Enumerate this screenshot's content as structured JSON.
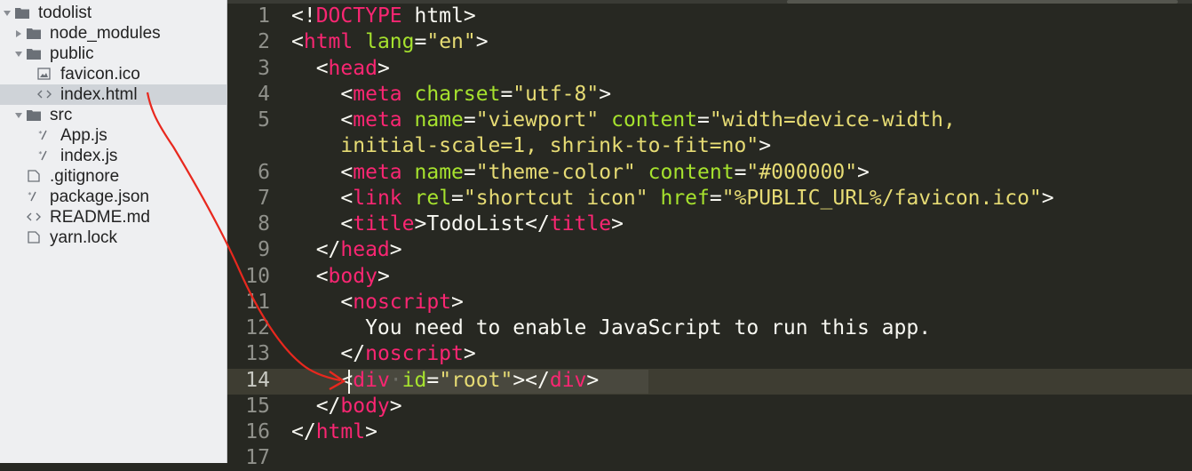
{
  "sidebar": {
    "items": [
      {
        "label": "todolist",
        "type": "folder",
        "expanded": true,
        "icon": "folder-icon"
      },
      {
        "label": "node_modules",
        "type": "folder",
        "expanded": false,
        "icon": "folder-icon"
      },
      {
        "label": "public",
        "type": "folder",
        "expanded": true,
        "icon": "folder-icon"
      },
      {
        "label": "favicon.ico",
        "type": "file",
        "icon": "image-file-icon"
      },
      {
        "label": "index.html",
        "type": "file",
        "icon": "markup-file-icon",
        "selected": true
      },
      {
        "label": "src",
        "type": "folder",
        "expanded": true,
        "icon": "folder-icon"
      },
      {
        "label": "App.js",
        "type": "file",
        "icon": "script-file-icon"
      },
      {
        "label": "index.js",
        "type": "file",
        "icon": "script-file-icon"
      },
      {
        "label": ".gitignore",
        "type": "file",
        "icon": "document-file-icon"
      },
      {
        "label": "package.json",
        "type": "file",
        "icon": "script-file-icon"
      },
      {
        "label": "README.md",
        "type": "file",
        "icon": "markup-file-icon"
      },
      {
        "label": "yarn.lock",
        "type": "file",
        "icon": "document-file-icon"
      }
    ]
  },
  "editor": {
    "current_line": 14,
    "line_numbers": [
      "1",
      "2",
      "3",
      "4",
      "5",
      "",
      "6",
      "7",
      "8",
      "9",
      "10",
      "11",
      "12",
      "13",
      "14",
      "15",
      "16",
      "17"
    ],
    "lines": [
      [
        {
          "c": "p",
          "t": "<!"
        },
        {
          "c": "t",
          "t": "DOCTYPE"
        },
        {
          "c": "p",
          "t": " html>"
        }
      ],
      [
        {
          "c": "p",
          "t": "<"
        },
        {
          "c": "t",
          "t": "html"
        },
        {
          "c": "p",
          "t": " "
        },
        {
          "c": "a",
          "t": "lang"
        },
        {
          "c": "p",
          "t": "="
        },
        {
          "c": "s",
          "t": "\"en\""
        },
        {
          "c": "p",
          "t": ">"
        }
      ],
      [
        {
          "c": "p",
          "t": "  <"
        },
        {
          "c": "t",
          "t": "head"
        },
        {
          "c": "p",
          "t": ">"
        }
      ],
      [
        {
          "c": "p",
          "t": "    <"
        },
        {
          "c": "t",
          "t": "meta"
        },
        {
          "c": "p",
          "t": " "
        },
        {
          "c": "a",
          "t": "charset"
        },
        {
          "c": "p",
          "t": "="
        },
        {
          "c": "s",
          "t": "\"utf-8\""
        },
        {
          "c": "p",
          "t": ">"
        }
      ],
      [
        {
          "c": "p",
          "t": "    <"
        },
        {
          "c": "t",
          "t": "meta"
        },
        {
          "c": "p",
          "t": " "
        },
        {
          "c": "a",
          "t": "name"
        },
        {
          "c": "p",
          "t": "="
        },
        {
          "c": "s",
          "t": "\"viewport\""
        },
        {
          "c": "p",
          "t": " "
        },
        {
          "c": "a",
          "t": "content"
        },
        {
          "c": "p",
          "t": "="
        },
        {
          "c": "s",
          "t": "\"width=device-width,"
        }
      ],
      [
        {
          "c": "s",
          "t": "    initial-scale=1, shrink-to-fit=no\""
        },
        {
          "c": "p",
          "t": ">"
        }
      ],
      [
        {
          "c": "p",
          "t": "    <"
        },
        {
          "c": "t",
          "t": "meta"
        },
        {
          "c": "p",
          "t": " "
        },
        {
          "c": "a",
          "t": "name"
        },
        {
          "c": "p",
          "t": "="
        },
        {
          "c": "s",
          "t": "\"theme-color\""
        },
        {
          "c": "p",
          "t": " "
        },
        {
          "c": "a",
          "t": "content"
        },
        {
          "c": "p",
          "t": "="
        },
        {
          "c": "s",
          "t": "\"#000000\""
        },
        {
          "c": "p",
          "t": ">"
        }
      ],
      [
        {
          "c": "p",
          "t": "    <"
        },
        {
          "c": "t",
          "t": "link"
        },
        {
          "c": "p",
          "t": " "
        },
        {
          "c": "a",
          "t": "rel"
        },
        {
          "c": "p",
          "t": "="
        },
        {
          "c": "s",
          "t": "\"shortcut icon\""
        },
        {
          "c": "p",
          "t": " "
        },
        {
          "c": "a",
          "t": "href"
        },
        {
          "c": "p",
          "t": "="
        },
        {
          "c": "s",
          "t": "\"%PUBLIC_URL%/favicon.ico\""
        },
        {
          "c": "p",
          "t": ">"
        }
      ],
      [
        {
          "c": "p",
          "t": "    <"
        },
        {
          "c": "t",
          "t": "title"
        },
        {
          "c": "p",
          "t": ">TodoList</"
        },
        {
          "c": "t",
          "t": "title"
        },
        {
          "c": "p",
          "t": ">"
        }
      ],
      [
        {
          "c": "p",
          "t": "  </"
        },
        {
          "c": "t",
          "t": "head"
        },
        {
          "c": "p",
          "t": ">"
        }
      ],
      [
        {
          "c": "p",
          "t": "  <"
        },
        {
          "c": "t",
          "t": "body"
        },
        {
          "c": "p",
          "t": ">"
        }
      ],
      [
        {
          "c": "p",
          "t": "    <"
        },
        {
          "c": "t",
          "t": "noscript"
        },
        {
          "c": "p",
          "t": ">"
        }
      ],
      [
        {
          "c": "p",
          "t": "      You need to enable JavaScript to run this app."
        }
      ],
      [
        {
          "c": "p",
          "t": "    </"
        },
        {
          "c": "t",
          "t": "noscript"
        },
        {
          "c": "p",
          "t": ">"
        }
      ],
      [
        {
          "c": "p",
          "t": "    <"
        },
        {
          "c": "t",
          "t": "div"
        },
        {
          "c": "ws",
          "t": "·"
        },
        {
          "c": "a",
          "t": "id"
        },
        {
          "c": "p",
          "t": "="
        },
        {
          "c": "s",
          "t": "\"root\""
        },
        {
          "c": "p",
          "t": "></"
        },
        {
          "c": "t",
          "t": "div"
        },
        {
          "c": "p",
          "t": ">"
        }
      ],
      [
        {
          "c": "p",
          "t": "  </"
        },
        {
          "c": "t",
          "t": "body"
        },
        {
          "c": "p",
          "t": ">"
        }
      ],
      [
        {
          "c": "p",
          "t": "</"
        },
        {
          "c": "t",
          "t": "html"
        },
        {
          "c": "p",
          "t": ">"
        }
      ],
      []
    ]
  },
  "colors": {
    "tag": "#f92672",
    "attribute": "#a6e22e",
    "string": "#e6db74",
    "plain": "#f8f8f2",
    "editor_bg": "#272822",
    "sidebar_bg": "#eeeff1",
    "selected_row": "#cfd3d8",
    "annotation": "#e8281e"
  }
}
